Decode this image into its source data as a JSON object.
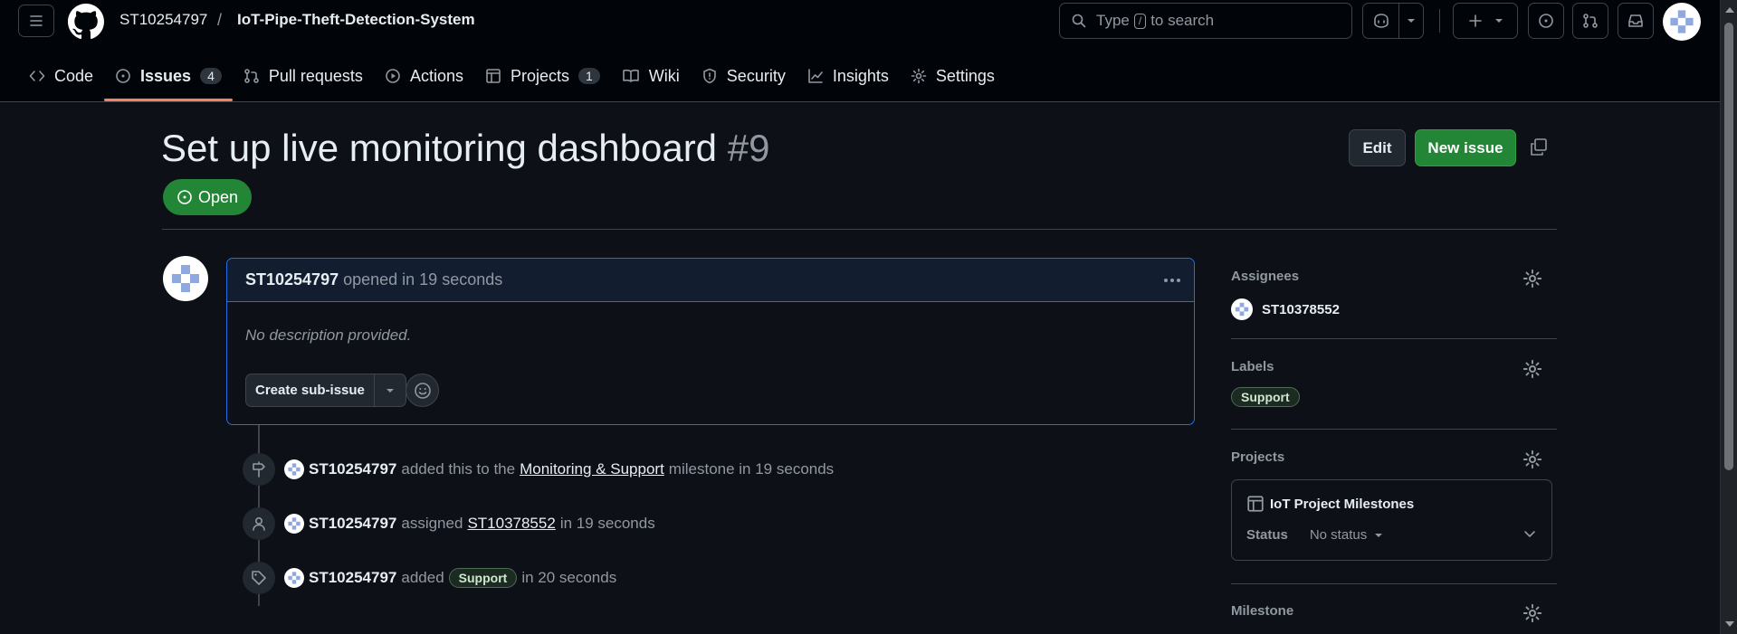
{
  "header": {
    "repo_owner": "ST10254797",
    "repo_separator": "/",
    "repo_name": "IoT-Pipe-Theft-Detection-System",
    "search_prefix": "Type",
    "search_key": "/",
    "search_suffix": "to search"
  },
  "tabs": [
    {
      "label": "Code",
      "icon": "code-icon"
    },
    {
      "label": "Issues",
      "icon": "issue-opened-icon",
      "count": "4",
      "active": true
    },
    {
      "label": "Pull requests",
      "icon": "git-pull-request-icon"
    },
    {
      "label": "Actions",
      "icon": "play-icon"
    },
    {
      "label": "Projects",
      "icon": "table-icon",
      "count": "1"
    },
    {
      "label": "Wiki",
      "icon": "book-icon"
    },
    {
      "label": "Security",
      "icon": "shield-icon"
    },
    {
      "label": "Insights",
      "icon": "graph-icon"
    },
    {
      "label": "Settings",
      "icon": "gear-icon"
    }
  ],
  "issue": {
    "title": "Set up live monitoring dashboard",
    "number": "#9",
    "state": "Open",
    "edit_label": "Edit",
    "new_issue_label": "New issue"
  },
  "comment": {
    "author": "ST10254797",
    "meta": "opened in 19 seconds",
    "body": "No description provided.",
    "create_sub_issue_label": "Create sub-issue"
  },
  "timeline": [
    {
      "icon": "milestone-icon",
      "actor": "ST10254797",
      "pre": "added this to the",
      "link": "Monitoring & Support",
      "post": "milestone in 19 seconds"
    },
    {
      "icon": "person-icon",
      "actor": "ST10254797",
      "pre": "assigned",
      "link": "ST10378552",
      "post": "in 19 seconds"
    },
    {
      "icon": "tag-icon",
      "actor": "ST10254797",
      "pre": "added",
      "label": "Support",
      "post": "in 20 seconds"
    }
  ],
  "sidebar": {
    "assignees": {
      "heading": "Assignees",
      "user": "ST10378552"
    },
    "labels": {
      "heading": "Labels",
      "items": [
        "Support"
      ]
    },
    "projects": {
      "heading": "Projects",
      "project_name": "IoT Project Milestones",
      "status_label": "Status",
      "status_value": "No status"
    },
    "milestone": {
      "heading": "Milestone"
    }
  },
  "colors": {
    "background": "#0d1117",
    "header_background": "#010409",
    "accent_green": "#238636",
    "active_tab_underline": "#f78166",
    "focus_border": "#1f6feb"
  }
}
